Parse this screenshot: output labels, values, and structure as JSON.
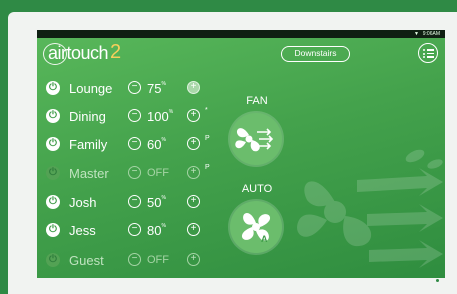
{
  "header": {
    "logo_text": "airtouch",
    "logo_version": "2",
    "zone_group_button": "Downstairs",
    "status_time": "9:06AM"
  },
  "zones": [
    {
      "name": "Lounge",
      "value": "75",
      "unit": "%",
      "on": true,
      "tag": ""
    },
    {
      "name": "Dining",
      "value": "100",
      "unit": "%",
      "on": true,
      "tag": "*"
    },
    {
      "name": "Family",
      "value": "60",
      "unit": "%",
      "on": true,
      "tag": "P"
    },
    {
      "name": "Master",
      "value": "OFF",
      "unit": "",
      "on": false,
      "tag": "P"
    },
    {
      "name": "Josh",
      "value": "50",
      "unit": "%",
      "on": true,
      "tag": ""
    },
    {
      "name": "Jess",
      "value": "80",
      "unit": "%",
      "on": true,
      "tag": ""
    },
    {
      "name": "Guest",
      "value": "OFF",
      "unit": "",
      "on": false,
      "tag": ""
    }
  ],
  "modes": {
    "fan_label": "FAN",
    "auto_label": "AUTO",
    "auto_badge": "A"
  },
  "icons": {
    "power": "power-icon",
    "minus": "minus-icon",
    "plus": "plus-icon",
    "menu": "menu-list-icon",
    "fan_mode": "fan-mode-icon",
    "auto_fan": "auto-fan-icon"
  },
  "colors": {
    "frame_green": "#2f8a45",
    "screen_green": "#44a24c",
    "control_white": "#ffffff"
  }
}
